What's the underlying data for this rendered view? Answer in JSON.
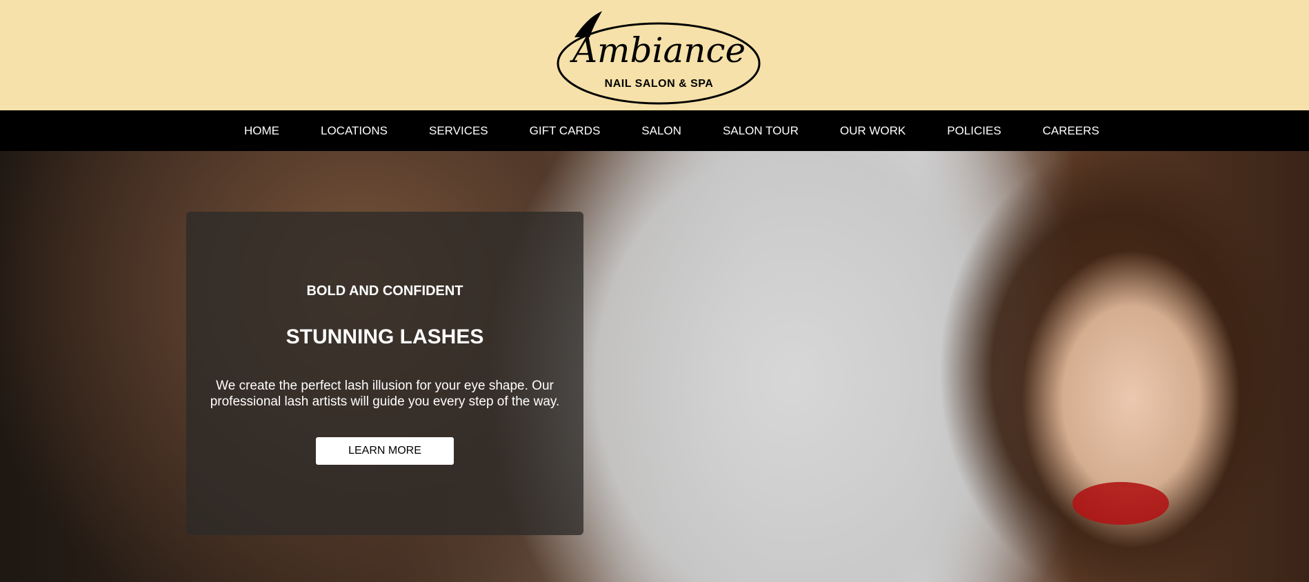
{
  "brand": {
    "logo_word": "Ambiance",
    "logo_sub": "NAIL SALON & SPA"
  },
  "nav": {
    "items": [
      "HOME",
      "LOCATIONS",
      "SERVICES",
      "GIFT CARDS",
      "SALON",
      "SALON TOUR",
      "OUR WORK",
      "POLICIES",
      "CAREERS"
    ]
  },
  "hero": {
    "eyebrow": "BOLD AND CONFIDENT",
    "title": "STUNNING LASHES",
    "description": "We create the perfect lash illusion for your eye shape. Our professional lash artists will guide you every step of the way.",
    "cta_label": "LEARN MORE"
  },
  "colors": {
    "header_bg": "#f5e1a9",
    "nav_bg": "#000000",
    "card_bg": "rgba(45,42,40,0.78)",
    "accent_lip": "#b01515"
  }
}
